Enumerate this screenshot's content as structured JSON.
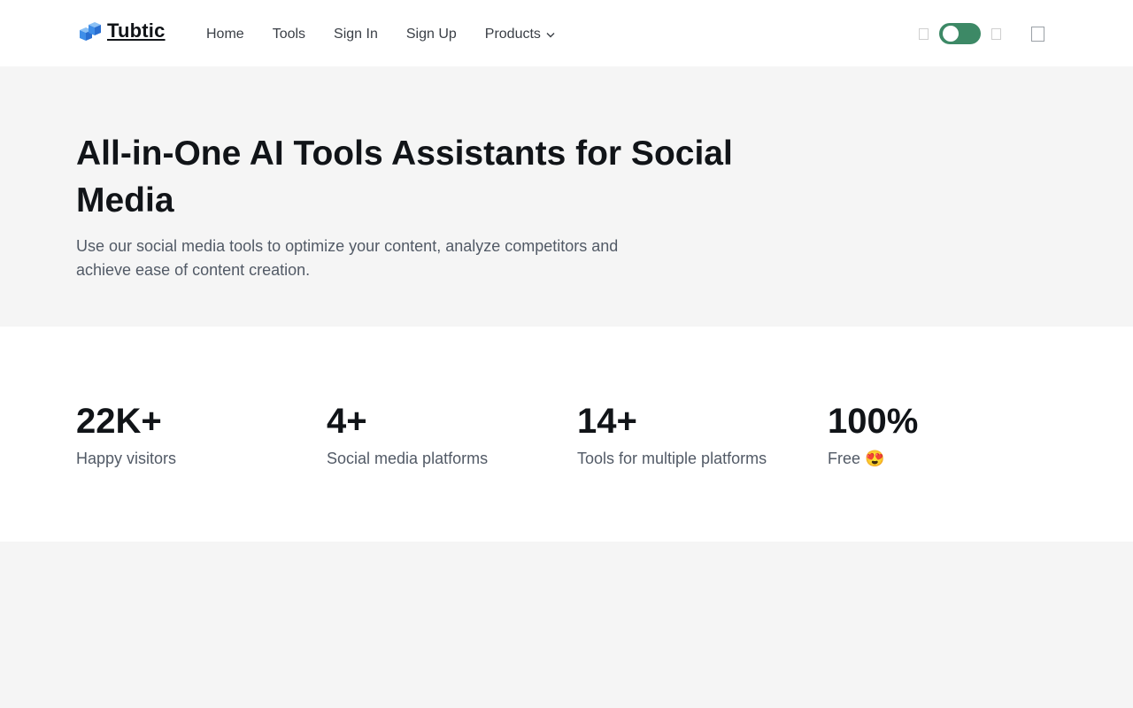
{
  "header": {
    "brand": "Tubtic",
    "nav": [
      {
        "label": "Home"
      },
      {
        "label": "Tools"
      },
      {
        "label": "Sign In"
      },
      {
        "label": "Sign Up"
      },
      {
        "label": "Products"
      }
    ],
    "theme_toggle_on": true,
    "toggle_color": "#3d8966"
  },
  "hero": {
    "title": "All-in-One AI Tools Assistants for Social Media",
    "subtitle": "Use our social media tools to optimize your content, analyze competitors and achieve ease of content creation."
  },
  "stats": [
    {
      "value": "22K+",
      "label": "Happy visitors"
    },
    {
      "value": "4+",
      "label": "Social media platforms"
    },
    {
      "value": "14+",
      "label": "Tools for multiple platforms"
    },
    {
      "value": "100%",
      "label": "Free 😍"
    }
  ],
  "icons": {
    "logo": "cube-logo-icon",
    "products_chevron": "chevron-down-icon",
    "light_mode": "sun-icon",
    "dark_mode": "moon-icon",
    "menu": "menu-icon"
  }
}
